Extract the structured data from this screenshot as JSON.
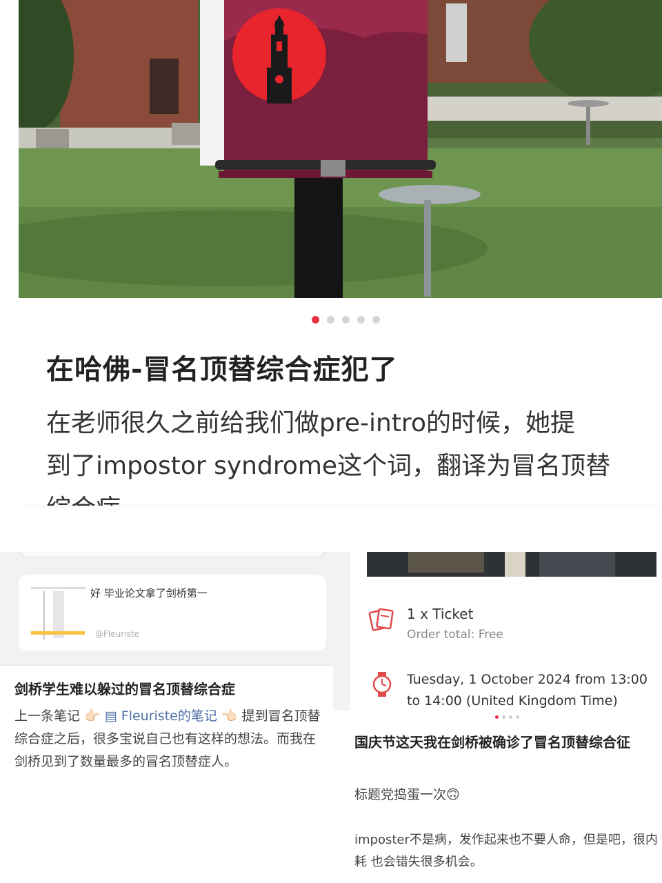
{
  "main_post": {
    "title": "在哈佛-冒名顶替综合症犯了",
    "body_line1": "在老师很久之前给我们做pre-intro的时候，她提",
    "body_line2": "到了impostor syndrome这个词，翻译为冒名顶替",
    "body_line3": "综合症",
    "carousel": {
      "total": 5,
      "active_index": 0
    },
    "image": "harvard-bell-tower-banner-on-campus-lawn"
  },
  "left_card": {
    "quote": {
      "text": "好 毕业论文拿了剑桥第一",
      "author": "@Fleuriste"
    },
    "title": "剑桥学生难以躲过的冒名顶替综合症",
    "body": {
      "prefix": "上一条笔记",
      "pointer_right": "👉🏻",
      "note_link": "Fleuriste的笔记",
      "pointer_left": "👈🏻",
      "suffix": "提到冒名顶替综合症之后，很多宝说自己也有这样的想法。而我在剑桥见到了数量最多的冒名顶替症人。"
    }
  },
  "right_card": {
    "ticket_line": "1 x Ticket",
    "order_total": "Order total: Free",
    "event_date": "Tuesday, 1 October 2024 from 13:00 to 14:00 (United Kingdom Time)",
    "carousel": {
      "total": 4,
      "active_index": 0
    },
    "title": "国庆节这天我在剑桥被确诊了冒名顶替综合征",
    "subtitle": "标题党捣蛋一次🙃",
    "body": "imposter不是病，发作起来也不要人命，但是吧，很内耗 也会错失很多机会。"
  },
  "colors": {
    "accent": "#ee2e45",
    "banner": "#7a1f3d",
    "link": "#4e6ea8"
  }
}
